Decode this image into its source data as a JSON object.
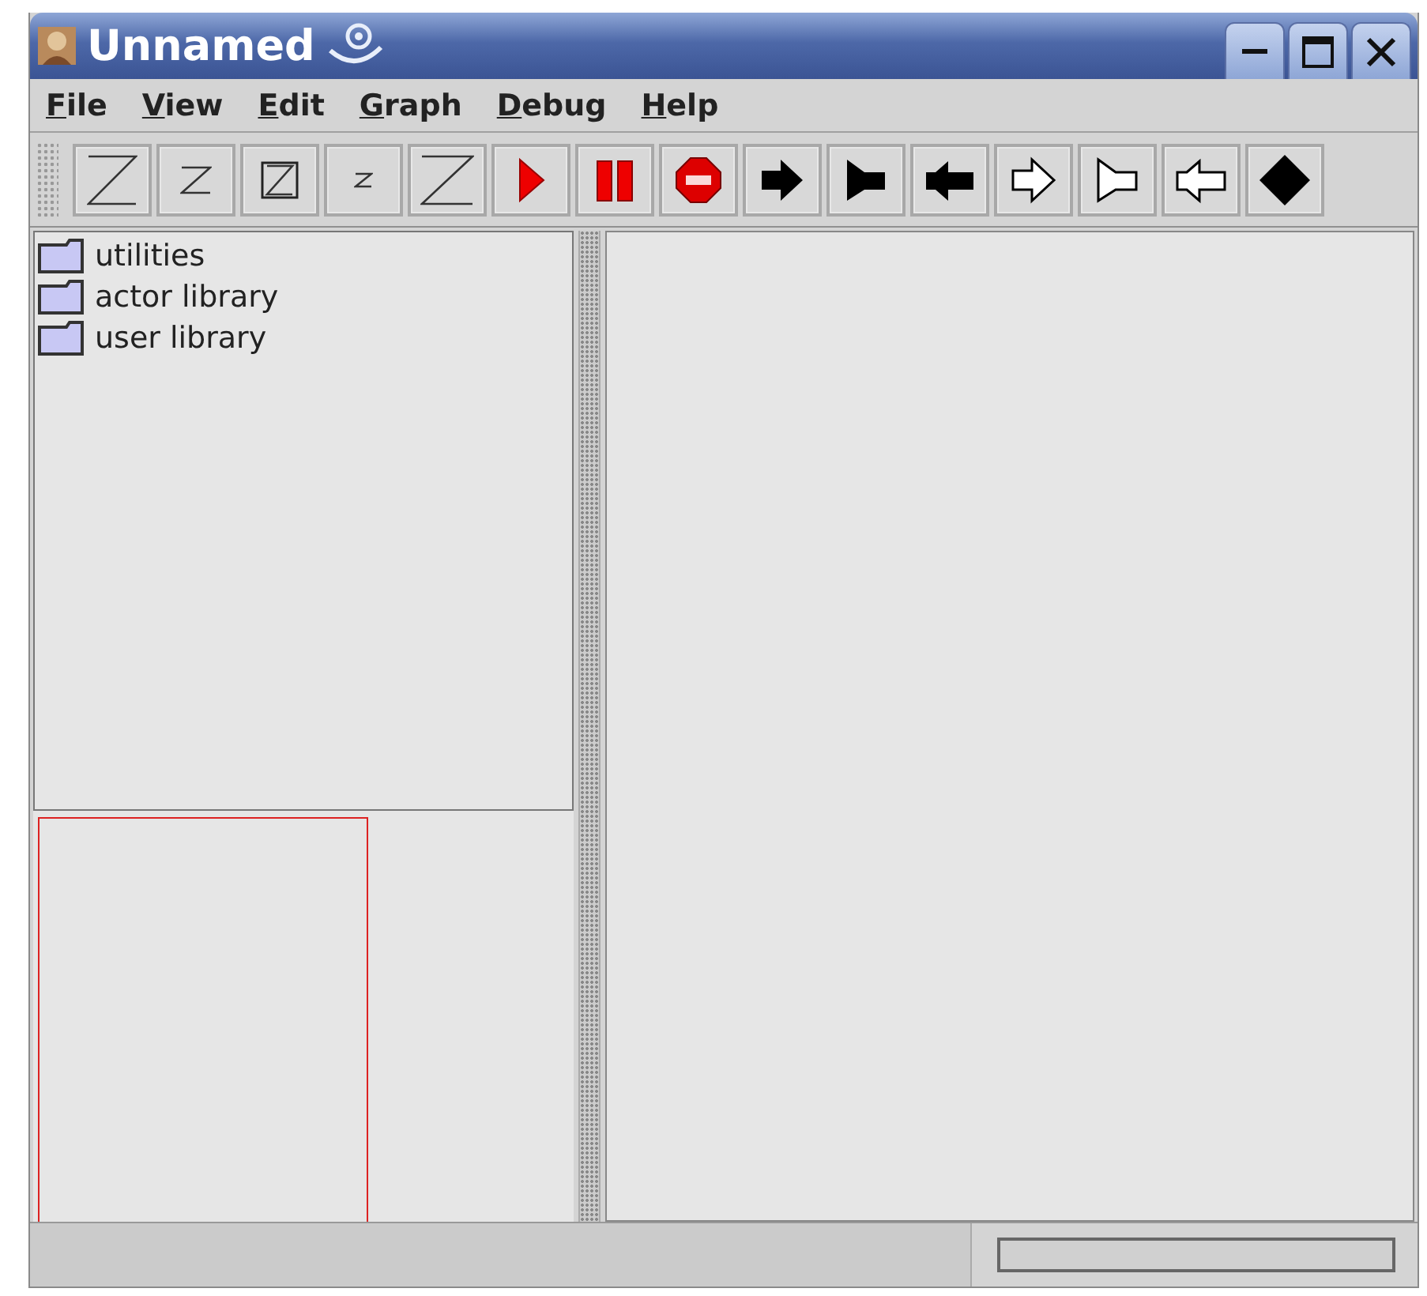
{
  "window": {
    "title": "Unnamed"
  },
  "menu": [
    "File",
    "View",
    "Edit",
    "Graph",
    "Debug",
    "Help"
  ],
  "toolbar": [
    {
      "kind": "z-large"
    },
    {
      "kind": "z-small"
    },
    {
      "kind": "z-boxed"
    },
    {
      "kind": "z-tiny"
    },
    {
      "kind": "z-thin"
    },
    {
      "kind": "play"
    },
    {
      "kind": "pause"
    },
    {
      "kind": "stop"
    },
    {
      "kind": "arrow-solid"
    },
    {
      "kind": "flag-solid"
    },
    {
      "kind": "double-solid"
    },
    {
      "kind": "arrow-outline"
    },
    {
      "kind": "flag-outline"
    },
    {
      "kind": "double-outline"
    },
    {
      "kind": "diamond"
    }
  ],
  "library_tree": [
    {
      "label": "utilities"
    },
    {
      "label": "actor library"
    },
    {
      "label": "user library"
    }
  ]
}
